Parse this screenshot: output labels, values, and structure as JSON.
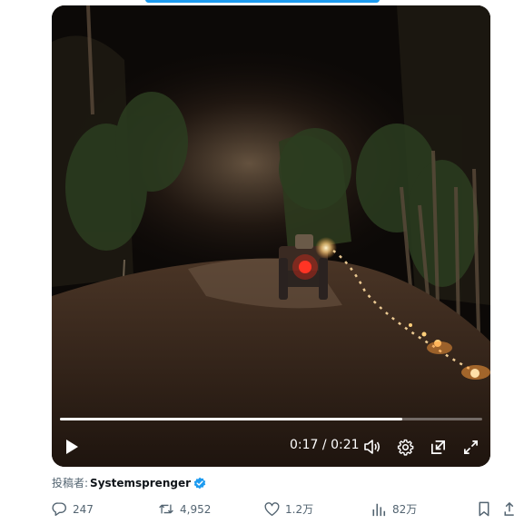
{
  "video": {
    "time_current": "0:17",
    "time_separator": "/",
    "time_total": "0:21",
    "progress": 0.81,
    "controls": [
      "play-icon",
      "volume-icon",
      "settings-icon",
      "pop-out-icon",
      "fullscreen-icon"
    ]
  },
  "post": {
    "byline_prefix": "投稿者:",
    "author": "Systemsprenger",
    "verified": true,
    "accent_color": "#1d9bf0"
  },
  "actions": {
    "replies": "247",
    "reposts": "4,952",
    "likes": "1.2万",
    "views": "82万"
  }
}
